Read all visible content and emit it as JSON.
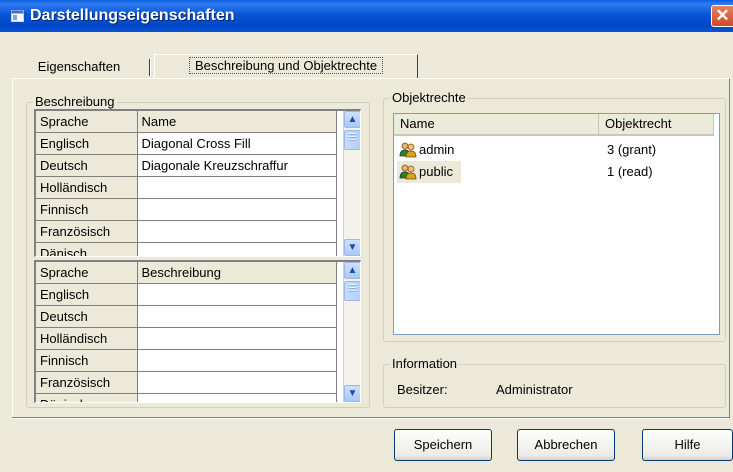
{
  "window": {
    "title": "Darstellungseigenschaften",
    "close_glyph": "✕"
  },
  "tabs": [
    {
      "label": "Eigenschaften",
      "active": false
    },
    {
      "label": "Beschreibung und Objektrechte",
      "active": true
    }
  ],
  "beschreibung": {
    "legend": "Beschreibung",
    "name_grid": {
      "headers": [
        "Sprache",
        "Name"
      ],
      "rows": [
        [
          "Englisch",
          "Diagonal Cross Fill"
        ],
        [
          "Deutsch",
          "Diagonale Kreuzschraffur"
        ],
        [
          "Holländisch",
          ""
        ],
        [
          "Finnisch",
          ""
        ],
        [
          "Französisch",
          ""
        ],
        [
          "Dänisch",
          ""
        ]
      ]
    },
    "desc_grid": {
      "headers": [
        "Sprache",
        "Beschreibung"
      ],
      "rows": [
        [
          "Englisch",
          ""
        ],
        [
          "Deutsch",
          ""
        ],
        [
          "Holländisch",
          ""
        ],
        [
          "Finnisch",
          ""
        ],
        [
          "Französisch",
          ""
        ],
        [
          "Dänisch",
          ""
        ]
      ]
    },
    "scroll_up_glyph": "▲",
    "scroll_down_glyph": "▼"
  },
  "objektrechte": {
    "legend": "Objektrechte",
    "columns": [
      "Name",
      "Objektrecht"
    ],
    "rows": [
      {
        "name": "admin",
        "recht": "3 (grant)",
        "icon": "users-icon",
        "selected": false
      },
      {
        "name": "public",
        "recht": "1 (read)",
        "icon": "users-icon",
        "selected": true
      }
    ]
  },
  "information": {
    "legend": "Information",
    "owner_label": "Besitzer:",
    "owner_value": "Administrator"
  },
  "buttons": {
    "save": "Speichern",
    "cancel": "Abbrechen",
    "help": "Hilfe"
  },
  "colors": {
    "titlebar": "#0a55d6",
    "close": "#cc4a2a",
    "dialog_bg": "#ece9d8",
    "selection": "#ece9d8"
  }
}
